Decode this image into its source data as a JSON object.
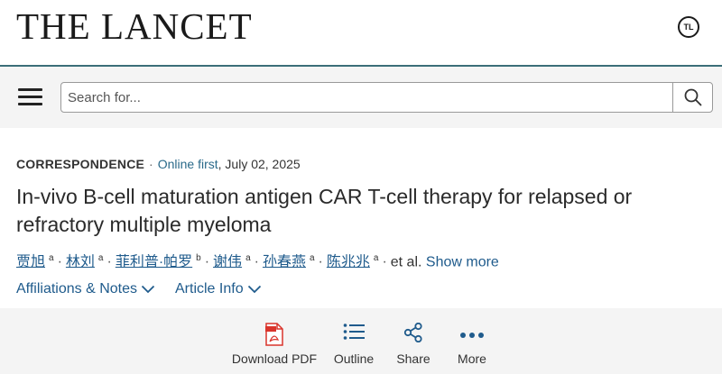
{
  "journal": {
    "name": "THE LANCET",
    "badge": "TL"
  },
  "search": {
    "placeholder": "Search for..."
  },
  "article": {
    "type": "CORRESPONDENCE",
    "status": "Online first",
    "date": ", July 02, 2025",
    "title": "In-vivo B-cell maturation antigen CAR T-cell therapy for relapsed or refractory multiple myeloma",
    "authors": [
      {
        "name": "贾旭",
        "sup": "a"
      },
      {
        "name": "林刘",
        "sup": "a"
      },
      {
        "name": "菲利普·帕罗",
        "sup": "b"
      },
      {
        "name": "谢伟",
        "sup": "a"
      },
      {
        "name": "孙春燕",
        "sup": "a"
      },
      {
        "name": "陈兆兆",
        "sup": "a"
      }
    ],
    "et_al": "et al.",
    "show_more": "Show more",
    "affiliations": "Affiliations & Notes",
    "article_info": "Article Info"
  },
  "toolbar": {
    "download_pdf": "Download PDF",
    "outline": "Outline",
    "share": "Share",
    "more": "More"
  },
  "colors": {
    "accent": "#3b6e78",
    "link": "#1f5b8c",
    "pdf_red": "#d9342b"
  }
}
